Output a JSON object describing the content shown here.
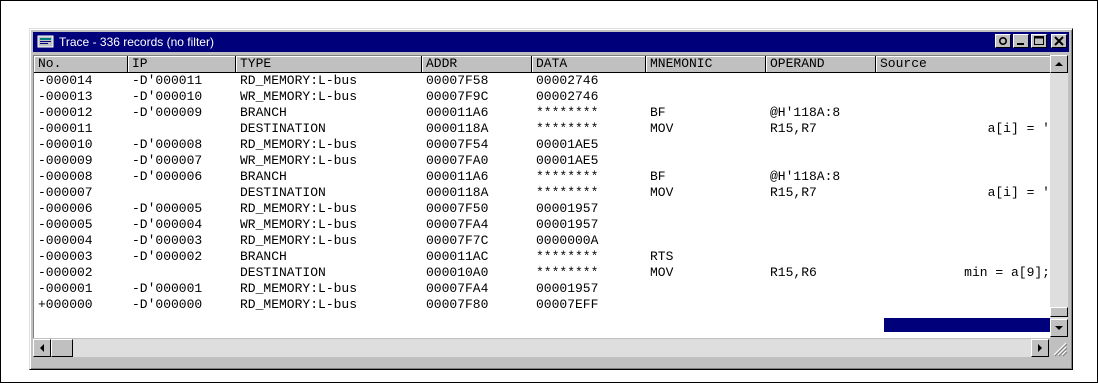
{
  "window": {
    "title": "Trace - 336 records (no filter)"
  },
  "columns": [
    "No.",
    "IP",
    "TYPE",
    "ADDR",
    "DATA",
    "MNEMONIC",
    "OPERAND",
    "Source"
  ],
  "rows": [
    [
      "-000014",
      "-D'000011",
      "RD_MEMORY:L-bus",
      "00007F58",
      "00002746",
      "",
      "",
      ""
    ],
    [
      "-000013",
      "-D'000010",
      "WR_MEMORY:L-bus",
      "00007F9C",
      "00002746",
      "",
      "",
      ""
    ],
    [
      "-000012",
      "-D'000009",
      "BRANCH",
      "000011A6",
      "********",
      "BF",
      "@H'118A:8",
      ""
    ],
    [
      "-000011",
      "",
      "DESTINATION",
      "0000118A",
      "********",
      "MOV",
      "R15,R7",
      "a[i] = '"
    ],
    [
      "-000010",
      "-D'000008",
      "RD_MEMORY:L-bus",
      "00007F54",
      "00001AE5",
      "",
      "",
      ""
    ],
    [
      "-000009",
      "-D'000007",
      "WR_MEMORY:L-bus",
      "00007FA0",
      "00001AE5",
      "",
      "",
      ""
    ],
    [
      "-000008",
      "-D'000006",
      "BRANCH",
      "000011A6",
      "********",
      "BF",
      "@H'118A:8",
      ""
    ],
    [
      "-000007",
      "",
      "DESTINATION",
      "0000118A",
      "********",
      "MOV",
      "R15,R7",
      "a[i] = '"
    ],
    [
      "-000006",
      "-D'000005",
      "RD_MEMORY:L-bus",
      "00007F50",
      "00001957",
      "",
      "",
      ""
    ],
    [
      "-000005",
      "-D'000004",
      "WR_MEMORY:L-bus",
      "00007FA4",
      "00001957",
      "",
      "",
      ""
    ],
    [
      "-000004",
      "-D'000003",
      "RD_MEMORY:L-bus",
      "00007F7C",
      "0000000A",
      "",
      "",
      ""
    ],
    [
      "-000003",
      "-D'000002",
      "BRANCH",
      "000011AC",
      "********",
      "RTS",
      "",
      ""
    ],
    [
      "-000002",
      "",
      "DESTINATION",
      "000010A0",
      "********",
      "MOV",
      "R15,R6",
      "min = a[9];"
    ],
    [
      "-000001",
      "-D'000001",
      "RD_MEMORY:L-bus",
      "00007FA4",
      "00001957",
      "",
      "",
      ""
    ],
    [
      "+000000",
      "-D'000000",
      "RD_MEMORY:L-bus",
      "00007F80",
      "00007EFF",
      "",
      "",
      ""
    ]
  ],
  "colors": {
    "titlebar": "#00007a",
    "face": "#c0c0c0",
    "selection": "#00007a"
  },
  "icons": [
    "trace-window-icon",
    "restore-icon",
    "minimize-icon",
    "maximize-icon",
    "close-icon",
    "scroll-up-icon",
    "scroll-down-icon",
    "scroll-left-icon",
    "scroll-right-icon",
    "resize-grip-icon"
  ]
}
